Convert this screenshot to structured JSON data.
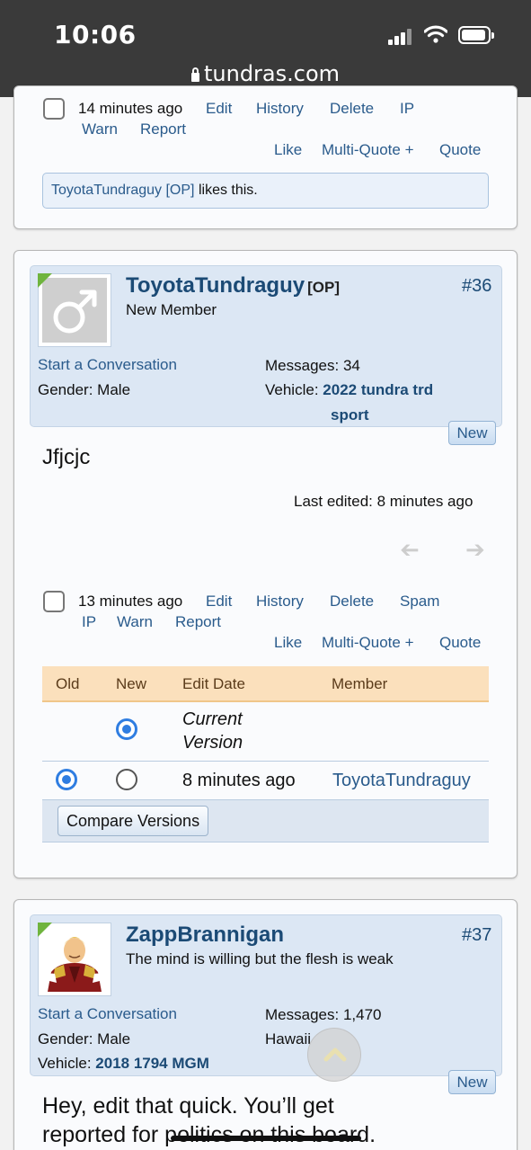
{
  "status_bar": {
    "time": "10:06",
    "url": "tundras.com"
  },
  "post35_footer": {
    "time": "14 minutes ago",
    "actions": [
      "Edit",
      "History",
      "Delete",
      "IP",
      "Warn",
      "Report"
    ],
    "right_actions": [
      "Like",
      "Multi-Quote +",
      "Quote"
    ],
    "likes": {
      "user": "ToyotaTundraguy [OP]",
      "text": "likes this."
    }
  },
  "post36": {
    "username": "ToyotaTundraguy",
    "op_tag": "[OP]",
    "number": "#36",
    "title": "New Member",
    "start_conversation": "Start a Conversation",
    "gender_label": "Gender:",
    "gender": "Male",
    "messages_label": "Messages:",
    "messages": "34",
    "vehicle_label": "Vehicle:",
    "vehicle_line1": "2022 tundra trd",
    "vehicle_line2": "sport",
    "new_badge": "New",
    "message": "Jfjcjc",
    "last_edited": "Last edited: 8 minutes ago",
    "time": "13 minutes ago",
    "actions": [
      "Edit",
      "History",
      "Delete",
      "Spam",
      "IP",
      "Warn",
      "Report"
    ],
    "right_actions": [
      "Like",
      "Multi-Quote +",
      "Quote"
    ],
    "history": {
      "headers": [
        "Old",
        "New",
        "Edit Date",
        "Member"
      ],
      "current_line1": "Current",
      "current_line2": "Version",
      "row2_date": "8 minutes ago",
      "row2_member": "ToyotaTundraguy",
      "compare_button": "Compare Versions"
    }
  },
  "post37": {
    "username": "ZappBrannigan",
    "number": "#37",
    "title": "The mind is willing but the flesh is weak",
    "start_conversation": "Start a Conversation",
    "gender_label": "Gender:",
    "gender": "Male",
    "messages_label": "Messages:",
    "messages": "1,470",
    "location": "Hawaii",
    "vehicle_label": "Vehicle:",
    "vehicle": "2018 1794 MGM",
    "new_badge": "New",
    "message_line1": "Hey, edit that quick. You’ll get",
    "message_line2": "reported for politics on this board."
  }
}
